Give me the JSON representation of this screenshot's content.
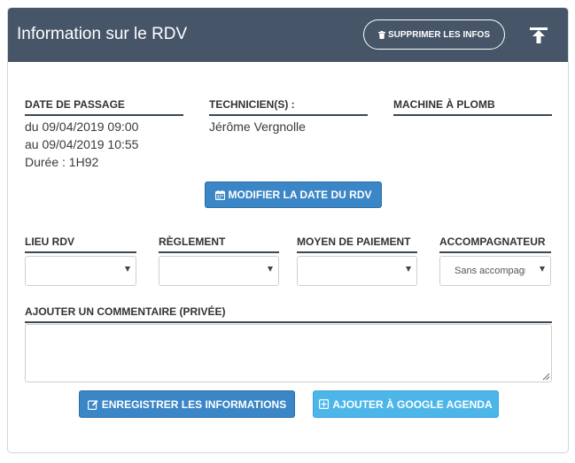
{
  "header": {
    "title": "Information sur le RDV",
    "delete_label": "SUPPRIMER LES INFOS"
  },
  "passage": {
    "label": "DATE DE PASSAGE",
    "from": "du 09/04/2019 09:00",
    "to": "au 09/04/2019 10:55",
    "duration": "Durée : 1H92"
  },
  "technicians": {
    "label": "TECHNICIEN(S) :",
    "name": "Jérôme Vergnolle"
  },
  "machine": {
    "label": "MACHINE À PLOMB"
  },
  "modify_date_label": "MODIFIER LA DATE DU RDV",
  "fields": {
    "lieu": {
      "label": "LIEU RDV",
      "value": ""
    },
    "reglement": {
      "label": "RÈGLEMENT",
      "value": ""
    },
    "moyen": {
      "label": "MOYEN DE PAIEMENT",
      "value": ""
    },
    "accompagnateur": {
      "label": "ACCOMPAGNATEUR",
      "value": "Sans accompagnateur"
    }
  },
  "comment": {
    "label": "AJOUTER UN COMMENTAIRE (PRIVÉE)",
    "value": ""
  },
  "actions": {
    "save_label": "ENREGISTRER LES INFORMATIONS",
    "google_label": "AJOUTER À GOOGLE AGENDA"
  },
  "icons": {
    "delete": "trash-icon",
    "upload": "upload-icon",
    "calendar": "calendar-icon",
    "edit": "edit-icon",
    "add": "plus-square-icon"
  },
  "colors": {
    "header_bg": "#475569",
    "primary_button": "#3a86c6",
    "secondary_button": "#4db6e9"
  }
}
